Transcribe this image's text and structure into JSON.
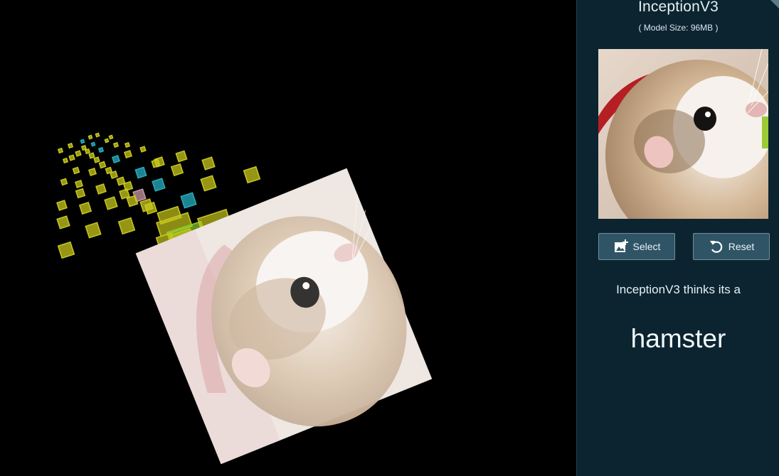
{
  "panel": {
    "model_name": "InceptionV3",
    "model_size": "( Model Size: 96MB )",
    "select_label": "Select",
    "reset_label": "Reset",
    "thinks_text": "InceptionV3 thinks its a",
    "prediction": "hamster"
  },
  "icons": {
    "select": "add-image-icon",
    "reset": "reset-icon"
  },
  "colors": {
    "panel_bg": "#0b2430",
    "button_bg": "#2f5466",
    "viz_bg": "#000000",
    "activation_yellow": "#c8c81e",
    "activation_cyan": "#25b0c0",
    "activation_pink": "#c99aa6",
    "activation_green": "#8ccf2e"
  }
}
